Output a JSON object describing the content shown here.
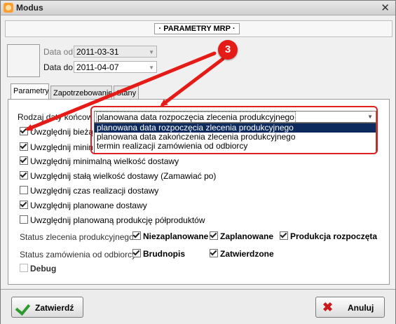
{
  "window": {
    "title": "Modus",
    "close_glyph": "✕"
  },
  "header": {
    "title": "· PARAMETRY MRP ·"
  },
  "dates": {
    "from_label": "Data od",
    "from_value": "2011-03-31",
    "to_label": "Data do",
    "to_value": "2011-04-07",
    "arrow_glyph": "▼"
  },
  "tabs": [
    {
      "label": "Parametry",
      "active": true
    },
    {
      "label": "Zapotrzebowanie",
      "active": false
    },
    {
      "label": "Stany",
      "active": false
    }
  ],
  "form": {
    "date_type_label": "Rodzaj daty końcowej",
    "combo_value": "planowana data rozpoczęcia zlecenia produkcyjnego",
    "combo_arrow": "▼",
    "options": [
      "planowana data rozpoczęcia zlecenia produkcyjnego",
      "planowana data zakończenia zlecenia produkcyjnego",
      "termin realizacji zamówienia od odbiorcy"
    ],
    "checkboxes": [
      {
        "label": "Uwzględnij bieżący stan",
        "checked": true
      },
      {
        "label": "Uwzględnij minimalny stan",
        "checked": true
      },
      {
        "label": "Uwzględnij minimalną wielkość dostawy",
        "checked": true
      },
      {
        "label": "Uwzględnij stałą wielkość dostawy (Zamawiać po)",
        "checked": true
      },
      {
        "label": "Uwzględnij czas realizacji dostawy",
        "checked": false
      },
      {
        "label": "Uwzględnij planowane dostawy",
        "checked": true
      },
      {
        "label": "Uwzględnij planowaną produkcję półproduktów",
        "checked": false
      }
    ],
    "production_status": {
      "label": "Status zlecenia produkcyjnego",
      "options": [
        {
          "label": "Niezaplanowane",
          "checked": true
        },
        {
          "label": "Zaplanowane",
          "checked": true
        },
        {
          "label": "Produkcja rozpoczęta",
          "checked": true
        }
      ]
    },
    "order_status": {
      "label": "Status zamówienia od odbiorcy",
      "options": [
        {
          "label": "Brudnopis",
          "checked": true
        },
        {
          "label": "Zatwierdzone",
          "checked": true
        }
      ]
    },
    "debug": {
      "label": "Debug",
      "checked": false
    }
  },
  "annotation": {
    "badge": "3",
    "color": "#e41b17"
  },
  "buttons": {
    "confirm": "Zatwierdź",
    "cancel": "Anuluj"
  }
}
